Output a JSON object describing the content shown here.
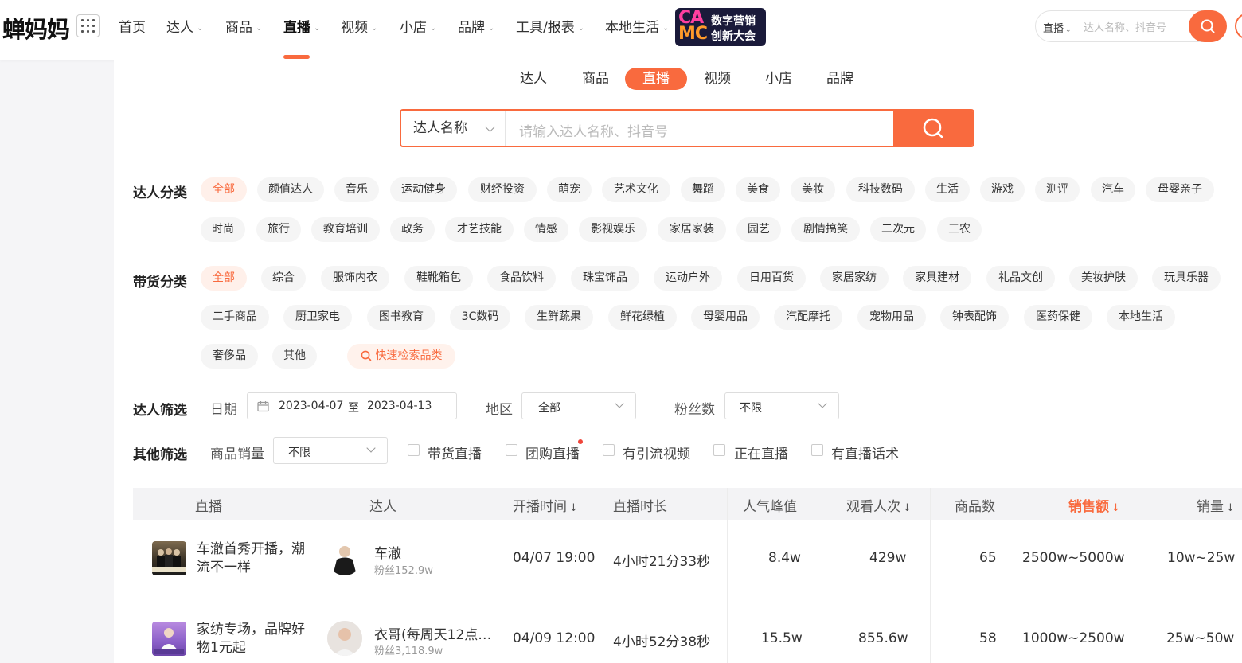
{
  "brand": {
    "logo_text": "蝉妈妈",
    "camc_big": "CA",
    "camc_big2": "MC",
    "camc_line1": "数字营销",
    "camc_line2": "创新大会"
  },
  "nav": {
    "items": [
      {
        "label": "首页",
        "dropdown": false
      },
      {
        "label": "达人",
        "dropdown": true
      },
      {
        "label": "商品",
        "dropdown": true
      },
      {
        "label": "直播",
        "dropdown": true,
        "active": true
      },
      {
        "label": "视频",
        "dropdown": true
      },
      {
        "label": "小店",
        "dropdown": true
      },
      {
        "label": "品牌",
        "dropdown": true
      },
      {
        "label": "工具/报表",
        "dropdown": true
      },
      {
        "label": "本地生活",
        "dropdown": true
      }
    ],
    "caret": "⌄"
  },
  "top_search": {
    "scope": "直播",
    "placeholder": "达人名称、抖音号"
  },
  "tabs": [
    "达人",
    "商品",
    "直播",
    "视频",
    "小店",
    "品牌"
  ],
  "active_tab": "直播",
  "search": {
    "scope": "达人名称",
    "placeholder": "请输入达人名称、抖音号"
  },
  "talent_category": {
    "label": "达人分类",
    "row1": [
      "全部",
      "颜值达人",
      "音乐",
      "运动健身",
      "财经投资",
      "萌宠",
      "艺术文化",
      "舞蹈",
      "美食",
      "美妆",
      "科技数码",
      "生活",
      "游戏",
      "测评",
      "汽车",
      "母婴亲子"
    ],
    "row2": [
      "时尚",
      "旅行",
      "教育培训",
      "政务",
      "才艺技能",
      "情感",
      "影视娱乐",
      "家居家装",
      "园艺",
      "剧情搞笑",
      "二次元",
      "三农"
    ]
  },
  "goods_category": {
    "label": "带货分类",
    "row1": [
      "全部",
      "综合",
      "服饰内衣",
      "鞋靴箱包",
      "食品饮料",
      "珠宝饰品",
      "运动户外",
      "日用百货",
      "家居家纺",
      "家具建材",
      "礼品文创",
      "美妆护肤",
      "玩具乐器"
    ],
    "row2": [
      "二手商品",
      "厨卫家电",
      "图书教育",
      "3C数码",
      "生鲜蔬果",
      "鲜花绿植",
      "母婴用品",
      "汽配摩托",
      "宠物用品",
      "钟表配饰",
      "医药保健",
      "本地生活"
    ],
    "row3": [
      "奢侈品",
      "其他"
    ],
    "quick_search": "快速检索品类"
  },
  "talent_filter": {
    "label": "达人筛选",
    "date_label": "日期",
    "date_start": "2023-04-07",
    "date_sep": "至",
    "date_end": "2023-04-13",
    "region_label": "地区",
    "region_value": "全部",
    "fans_label": "粉丝数",
    "fans_value": "不限"
  },
  "other_filter": {
    "label": "其他筛选",
    "sales_label": "商品销量",
    "sales_value": "不限",
    "checkboxes": [
      "带货直播",
      "团购直播",
      "有引流视频",
      "正在直播",
      "有直播话术"
    ]
  },
  "table": {
    "headers": {
      "live": "直播",
      "talent": "达人",
      "start_time": "开播时间",
      "duration": "直播时长",
      "peak": "人气峰值",
      "views": "观看人次",
      "goods_count": "商品数",
      "revenue": "销售额",
      "sales": "销量"
    },
    "sort_arrow": "↓",
    "rows": [
      {
        "title": "车澈首秀开播，潮流不一样",
        "talent": "车澈",
        "fans": "粉丝152.9w",
        "start_time": "04/07 19:00",
        "duration": "4小时21分33秒",
        "peak": "8.4w",
        "views": "429w",
        "goods_count": "65",
        "revenue": "2500w~5000w",
        "sales": "10w~25w"
      },
      {
        "title": "家纺专场，品牌好物1元起",
        "talent": "衣哥(每周天12点…",
        "fans": "粉丝3,118.9w",
        "start_time": "04/09 12:00",
        "duration": "4小时52分38秒",
        "peak": "15.5w",
        "views": "855.6w",
        "goods_count": "58",
        "revenue": "1000w~2500w",
        "sales": "25w~50w"
      }
    ]
  },
  "colors": {
    "accent": "#f96a3e",
    "chip_bg": "#f5f5f5",
    "page_bg": "#f5f5f7"
  }
}
